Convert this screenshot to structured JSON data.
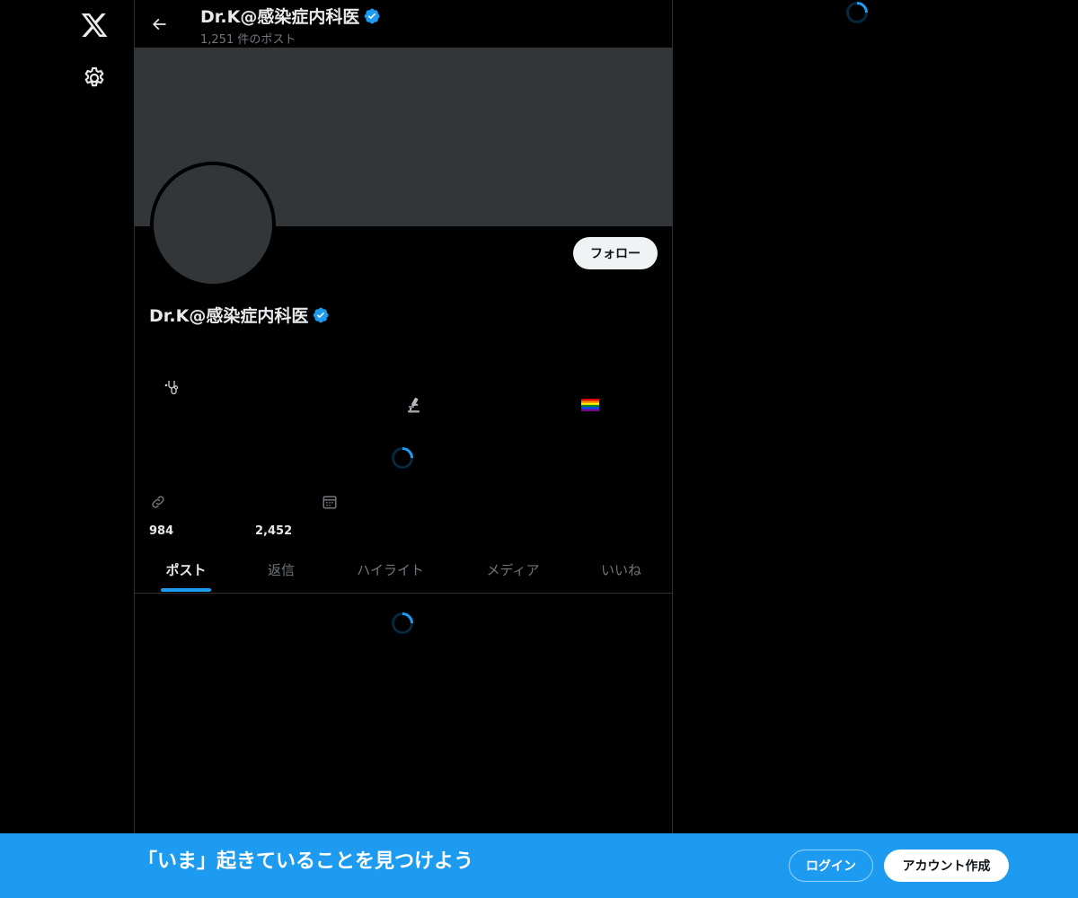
{
  "nav": {
    "logo_icon": "x-logo-icon",
    "settings_icon": "gear-icon"
  },
  "header": {
    "back_icon": "arrow-left-icon",
    "name": "Dr.K@感染症内科医",
    "post_count": "1,251 件のポスト"
  },
  "profile": {
    "name": "Dr.K@感染症内科医",
    "follow_label": "フォロー",
    "bio_emoji": [
      "🩺",
      "🔬",
      "🏳️‍🌈"
    ],
    "following_count": "984",
    "followers_count": "2,452"
  },
  "tabs": [
    {
      "label": "ポスト",
      "active": true
    },
    {
      "label": "返信",
      "active": false
    },
    {
      "label": "ハイライト",
      "active": false
    },
    {
      "label": "メディア",
      "active": false
    },
    {
      "label": "いいね",
      "active": false
    }
  ],
  "bottom_bar": {
    "title": "「いま」起きていることを見つけよう",
    "login_label": "ログイン",
    "signup_label": "アカウント作成"
  },
  "colors": {
    "accent": "#1d9bf0",
    "background": "#000000",
    "banner": "#333639",
    "text_primary": "#e7e9ea",
    "text_secondary": "#71767b"
  }
}
